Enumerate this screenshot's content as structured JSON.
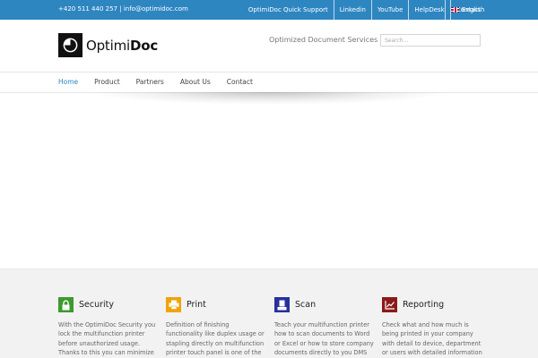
{
  "topbar": {
    "phone": "+420 511 440 257",
    "separator": "|",
    "email": "info@optimidoc.com",
    "links": [
      "OptimiDoc Quick Support",
      "Linkedin",
      "YouTube",
      "HelpDesk",
      "Contact"
    ],
    "language": "English"
  },
  "header": {
    "logo_light": "Optimi",
    "logo_bold": "Doc",
    "tagline": "Optimized Document Services",
    "search_placeholder": "Search..."
  },
  "nav": {
    "items": [
      "Home",
      "Product",
      "Partners",
      "About Us",
      "Contact"
    ],
    "active": "Home"
  },
  "colors": {
    "topbar": "#2e86c1",
    "active_nav": "#2e86c1",
    "security": "#3c9a2e",
    "print": "#f0a30a",
    "scan": "#2a2f9c",
    "reporting": "#8b1a1a"
  },
  "features": [
    {
      "icon": "lock-icon",
      "title": "Security",
      "desc": "With the OptimiDoc Security you lock the multifunction printer before unauthorized usage. Thanks to this you can minimize"
    },
    {
      "icon": "printer-icon",
      "title": "Print",
      "desc": "Definition of finishing functionality like duplex usage or stapling directly on multifunction printer touch panel is one of the features"
    },
    {
      "icon": "scanner-icon",
      "title": "Scan",
      "desc": "Teach your multifunction printer how to scan documents to Word or Excel or how to store company documents directly to you DMS"
    },
    {
      "icon": "chart-icon",
      "title": "Reporting",
      "desc": "Check what and how much is being printed in your company with detail to device, department or users with detailed information"
    }
  ]
}
